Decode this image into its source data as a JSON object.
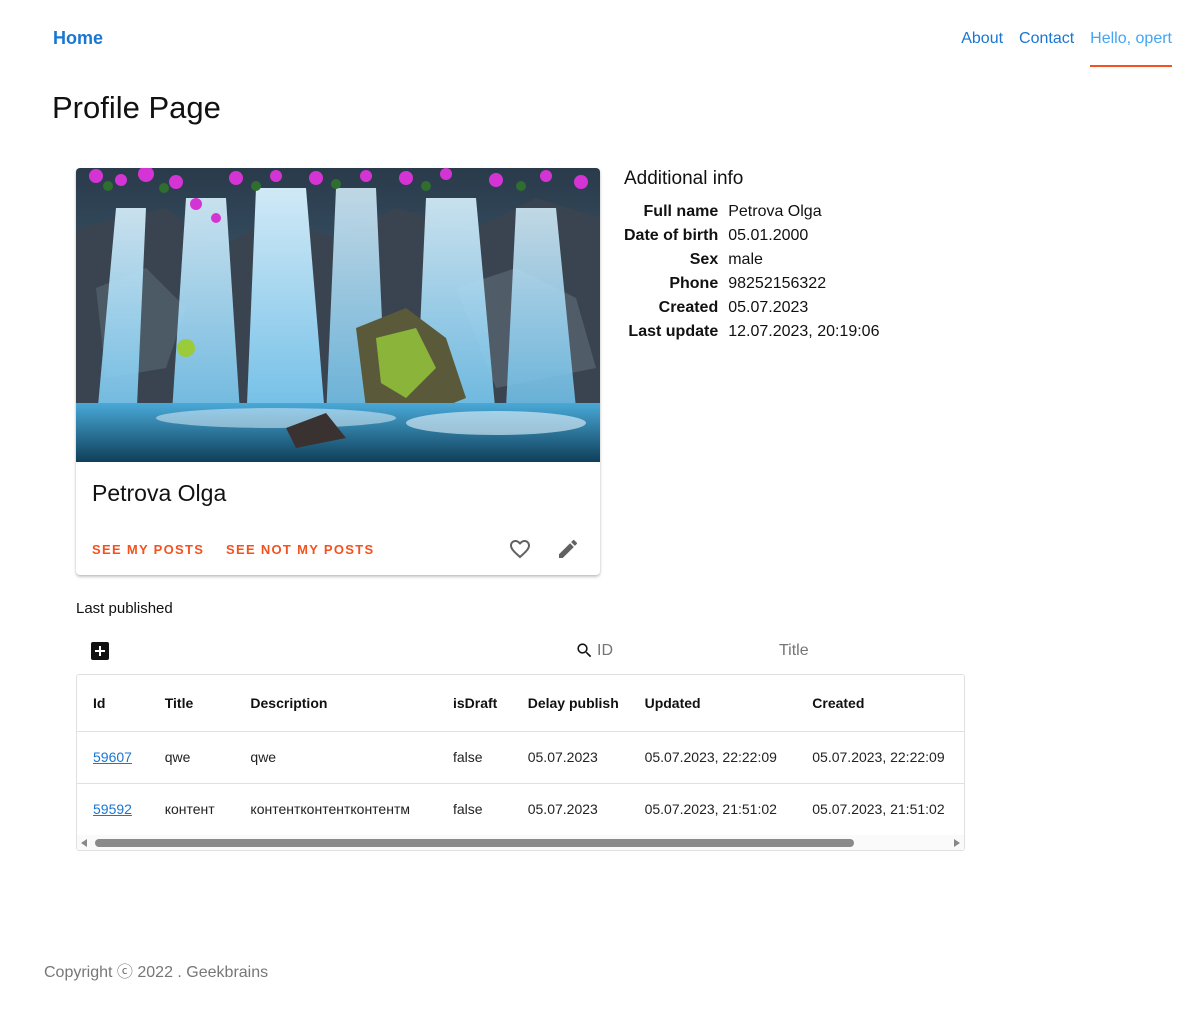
{
  "header": {
    "home": "Home",
    "nav": [
      "About",
      "Contact",
      "Hello, opert"
    ]
  },
  "page_title": "Profile Page",
  "card": {
    "name": "Petrova Olga",
    "buttons": [
      "SEE MY POSTS",
      "SEE NOT MY POSTS"
    ],
    "icons": [
      "heart-icon",
      "pencil-icon"
    ]
  },
  "info": {
    "title": "Additional info",
    "rows": [
      {
        "label": "Full name",
        "value": "Petrova Olga"
      },
      {
        "label": "Date of birth",
        "value": "05.01.2000"
      },
      {
        "label": "Sex",
        "value": "male"
      },
      {
        "label": "Phone",
        "value": "98252156322"
      },
      {
        "label": "Created",
        "value": "05.07.2023"
      },
      {
        "label": "Last update",
        "value": "12.07.2023, 20:19:06"
      }
    ]
  },
  "posts": {
    "title": "Last published",
    "filters": {
      "id_placeholder": "ID",
      "title_placeholder": "Title"
    },
    "columns": [
      "Id",
      "Title",
      "Description",
      "isDraft",
      "Delay publish",
      "Updated",
      "Created"
    ],
    "rows": [
      [
        "59607",
        "qwe",
        "qwe",
        "false",
        "05.07.2023",
        "05.07.2023, 22:22:09",
        "05.07.2023, 22:22:09"
      ],
      [
        "59592",
        "контент",
        "контентконтентконтентм",
        "false",
        "05.07.2023",
        "05.07.2023, 21:51:02",
        "05.07.2023, 21:51:02"
      ]
    ]
  },
  "footer": "Copyright ⓒ 2022 . Geekbrains",
  "colors": {
    "accent": "#1976d2",
    "link_active": "#42a5f5",
    "orange": "#f4511e"
  }
}
